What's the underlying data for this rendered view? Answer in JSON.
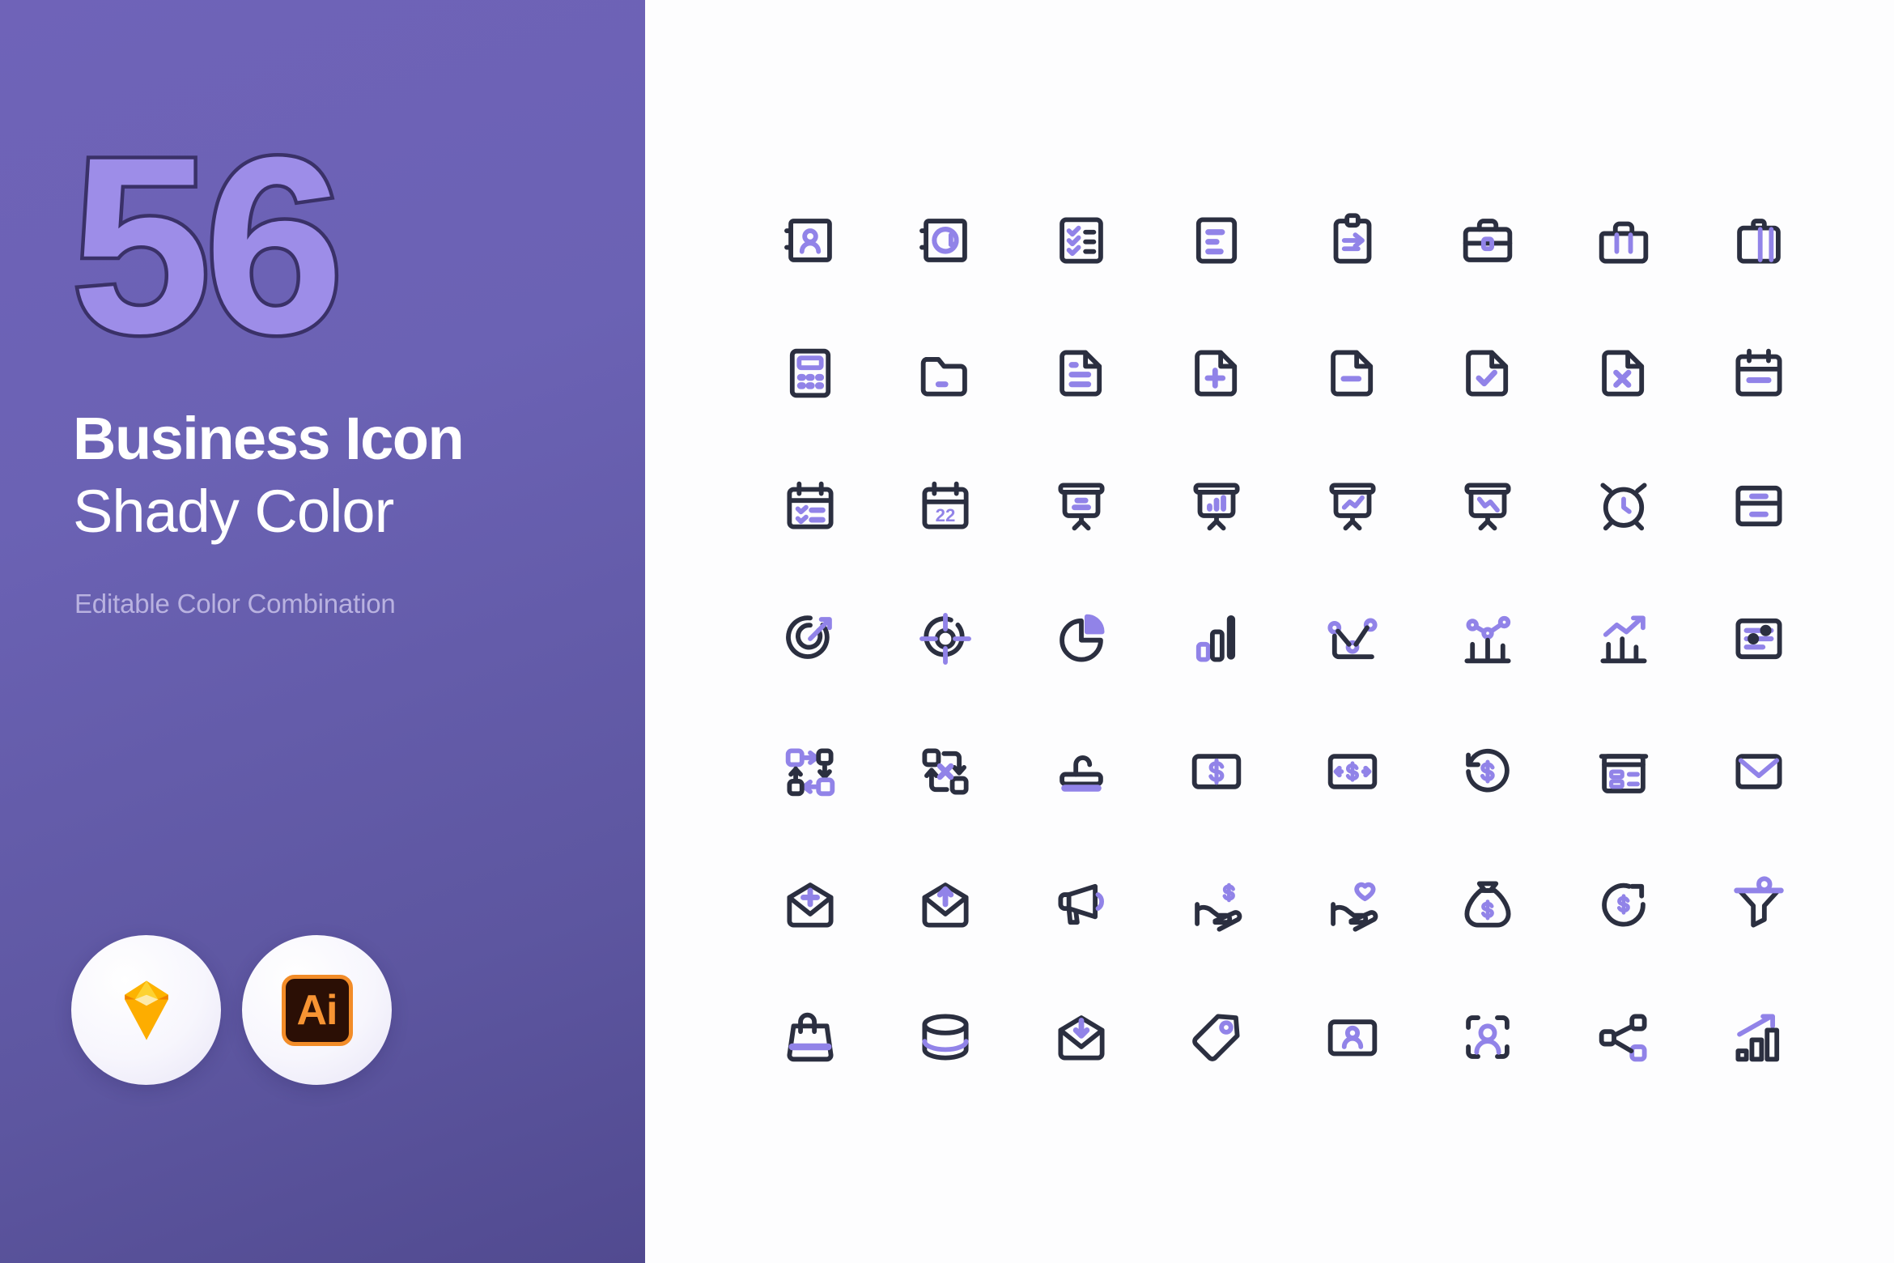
{
  "left_panel": {
    "count": "56",
    "title_main": "Business Icon",
    "title_sub": "Shady Color",
    "note": "Editable Color Combination",
    "badges": [
      {
        "name": "sketch-logo-badge",
        "label": ""
      },
      {
        "name": "adobe-illustrator-badge",
        "label": "Ai"
      }
    ],
    "colors": {
      "bg_gradient_start": "#6f63b8",
      "bg_gradient_end": "#514a90",
      "number_fill": "#9d8de8",
      "number_stroke": "#3a3168",
      "title_color": "#ffffff",
      "note_color": "#b9b2e0"
    }
  },
  "right_panel": {
    "background": "#fdfdfe",
    "colors": {
      "stroke_dark": "#2b2f40",
      "accent_purple": "#9183e8"
    },
    "columns": 8,
    "rows": 7,
    "icons": [
      "contact-book-icon",
      "email-book-icon",
      "checklist-clipboard-icon",
      "document-lines-icon",
      "clipboard-arrow-icon",
      "briefcase-icon",
      "briefcase-open-icon",
      "suitcase-icon",
      "calculator-icon",
      "folder-icon",
      "document-text-icon",
      "document-plus-icon",
      "document-minus-icon",
      "document-check-icon",
      "document-close-icon",
      "calendar-blank-icon",
      "calendar-checklist-icon",
      "calendar-date-icon",
      "presentation-board-icon",
      "presentation-bar-chart-icon",
      "presentation-line-up-icon",
      "presentation-line-down-icon",
      "alarm-clock-icon",
      "archive-box-icon",
      "target-arrow-icon",
      "crosshair-icon",
      "pie-chart-icon",
      "bar-chart-icon",
      "network-graph-icon",
      "analytics-chart-icon",
      "growth-chart-icon",
      "task-list-icon",
      "workflow-transfer-icon",
      "workflow-cancel-icon",
      "stamp-icon",
      "money-card-icon",
      "money-exchange-icon",
      "refund-clock-icon",
      "calculator-register-icon",
      "mail-envelope-icon",
      "mail-plus-icon",
      "mail-upload-icon",
      "megaphone-icon",
      "hand-money-icon",
      "hand-heart-icon",
      "money-bag-icon",
      "piggy-bank-icon",
      "sales-funnel-icon",
      "shopping-bag-icon",
      "database-icon",
      "mail-download-icon",
      "price-tag-icon",
      "id-card-icon",
      "face-scan-icon",
      "share-network-icon",
      "growth-bar-icon"
    ]
  }
}
